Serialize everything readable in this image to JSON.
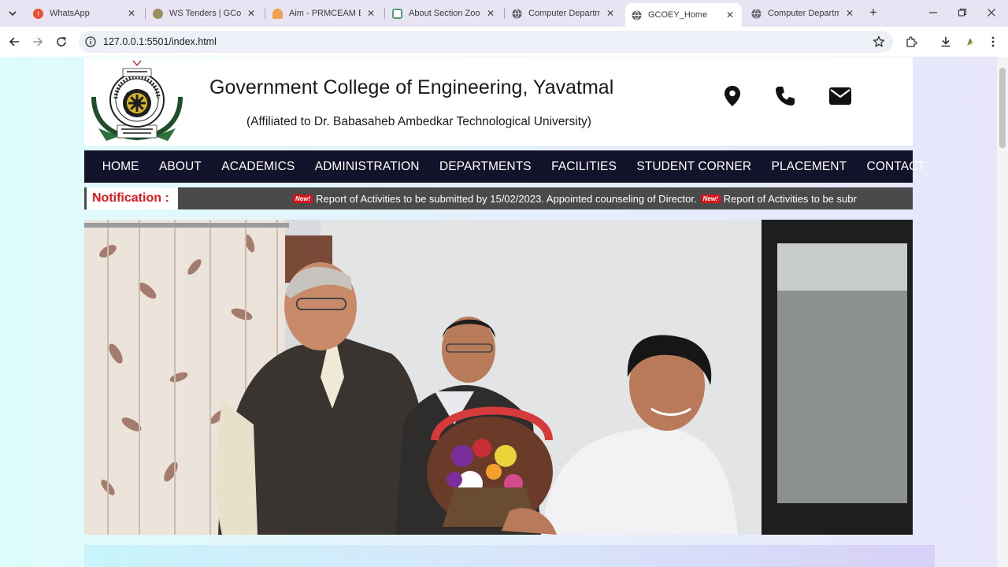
{
  "browser": {
    "tabs": [
      {
        "title": "WhatsApp",
        "icon": "whatsapp-icon"
      },
      {
        "title": "WS Tenders | GCoE, Y",
        "icon": "site-icon"
      },
      {
        "title": "Aim - PRMCEAM Bad",
        "icon": "site-icon"
      },
      {
        "title": "About Section Zoom",
        "icon": "site-icon"
      },
      {
        "title": "Computer Departme",
        "icon": "globe-icon"
      },
      {
        "title": "GCOEY_Home",
        "icon": "globe-icon",
        "active": true
      },
      {
        "title": "Computer Departme",
        "icon": "globe-icon"
      }
    ],
    "url": "127.0.0.1:5501/index.html"
  },
  "header": {
    "college_name": "Government College of Engineering, Yavatmal",
    "affiliation": "(Affiliated to Dr. Babasaheb Ambedkar Technological University)",
    "icons": [
      "location-icon",
      "phone-icon",
      "mail-icon"
    ]
  },
  "nav": {
    "items": [
      "HOME",
      "ABOUT",
      "ACADEMICS",
      "ADMINISTRATION",
      "DEPARTMENTS",
      "FACILITIES",
      "STUDENT CORNER",
      "PLACEMENT",
      "CONTACT"
    ]
  },
  "notification": {
    "label": "Notification :",
    "badge": "New!",
    "items": [
      "Report of Activities to be submitted by 15/02/2023. Appointed counseling of Director.",
      "Report of Activities to be subr"
    ]
  },
  "colors": {
    "nav_bg": "#12132b",
    "notif_label": "#e4141c",
    "notif_bg": "#4a4a4a"
  }
}
